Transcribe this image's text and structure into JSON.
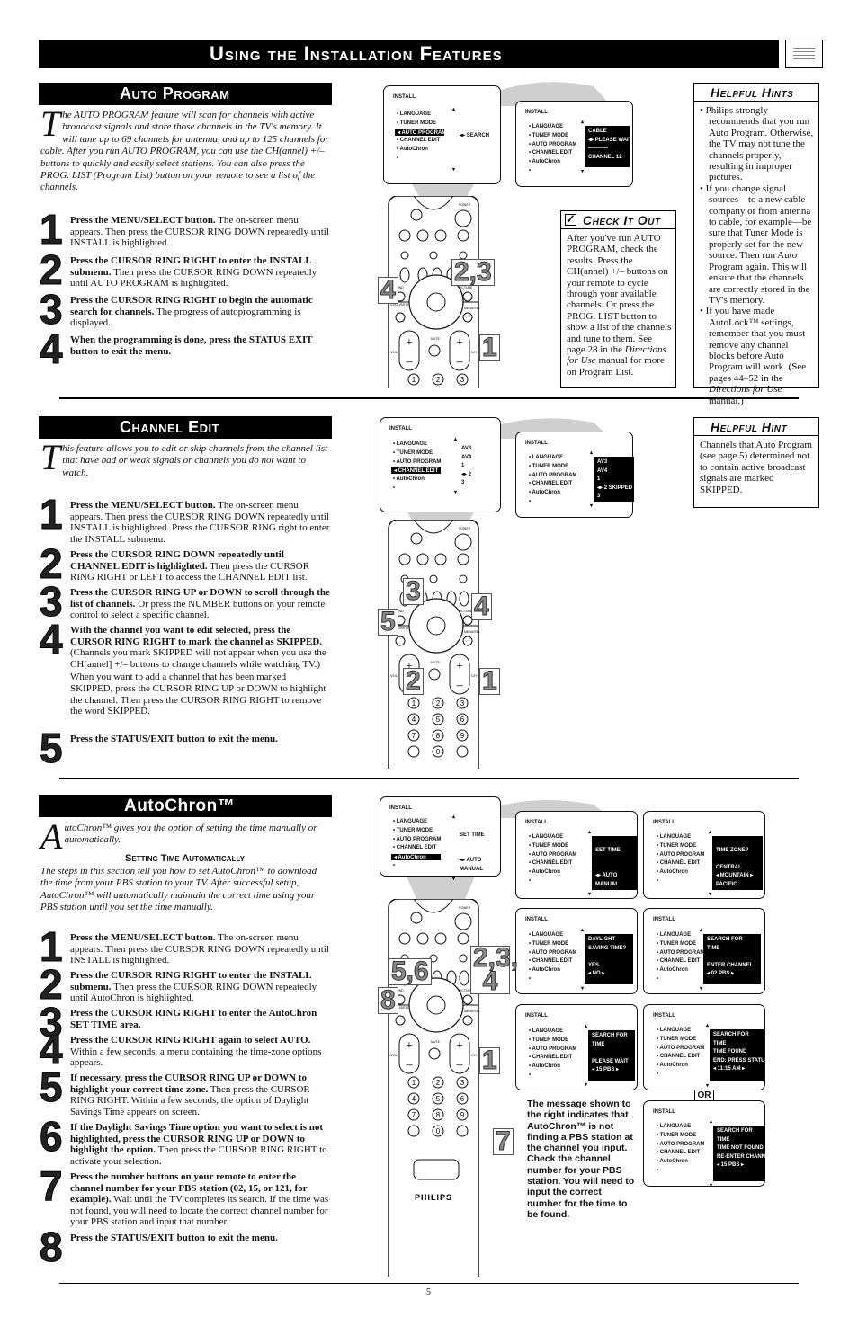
{
  "page_title": "Using the Installation Features",
  "page_number": "5",
  "auto_program": {
    "header": "Auto Program",
    "intro_drop": "T",
    "intro": "he AUTO PROGRAM feature will scan for channels with active broadcast signals and store those channels in the TV's memory. It will tune up to 69 channels for antenna, and up to 125 channels for cable. After you run AUTO PROGRAM, you can use the CH(annel) +/– buttons to quickly and easily select stations. You can also press the PROG. LIST (Program List) button on your remote to see a list of the channels.",
    "steps": [
      {
        "num": "1",
        "bold": "Press the MENU/SELECT button.",
        "text": " The on-screen menu appears. Then press the CURSOR RING DOWN repeatedly until INSTALL is highlighted."
      },
      {
        "num": "2",
        "bold": "Press the CURSOR RING RIGHT to enter the INSTALL submenu.",
        "text": " Then press the CURSOR RING DOWN repeatedly until AUTO PROGRAM is highlighted."
      },
      {
        "num": "3",
        "bold": "Press the CURSOR RING RIGHT to begin the automatic search for channels.",
        "text": " The progress of autoprogramming is displayed."
      },
      {
        "num": "4",
        "bold": "When the programming is done, press the STATUS EXIT button to exit the menu.",
        "text": ""
      }
    ],
    "screens": [
      {
        "title": "INSTALL",
        "items": [
          "LANGUAGE",
          "TUNER MODE",
          "AUTO PROGRAM",
          "CHANNEL EDIT",
          "AutoChron",
          ""
        ],
        "selected": 2,
        "inverted": false,
        "panel": [
          "",
          "",
          "◂▸ SEARCH",
          "",
          "",
          ""
        ]
      },
      {
        "title": "INSTALL",
        "items": [
          "LANGUAGE",
          "TUNER MODE",
          "AUTO PROGRAM",
          "CHANNEL EDIT",
          "AutoChron",
          ""
        ],
        "selected": -1,
        "inverted": true,
        "panel": [
          "CABLE",
          "◂▸ PLEASE WAIT",
          "━━━━━━",
          "CHANNEL   12"
        ]
      }
    ],
    "callouts": [
      "4",
      "2,3",
      "1"
    ],
    "helpful_hints": {
      "title": "Helpful Hints",
      "items": [
        [
          "Philips strongly recommends that you run Auto Program. Otherwise, the TV may not tune the channels properly, resulting in improper pictures."
        ],
        [
          "If you change signal sources—to a new cable company or from antenna to cable, for example—be sure that Tuner Mode is properly set for the new source. Then run Auto Program again. This will ensure that the channels are correctly stored in the TV's memory."
        ],
        [
          "If you have made AutoLock™ settings, remember that you must remove any channel blocks before Auto Program will work. (See pages 44–52 in the ",
          "Directions for Use",
          " manual.)"
        ]
      ]
    },
    "check_it_out": {
      "title": "Check It Out",
      "icon": "checkbox-icon",
      "parts": [
        "After you've run AUTO PROGRAM, check the results. Press the CH(annel) +/– buttons on your remote to cycle through your available channels. Or press the PROG. LIST button to show a list of the channels and tune to them. See page 28 in the ",
        "Directions for Use",
        " manual for more on Program List."
      ]
    }
  },
  "channel_edit": {
    "header": "Channel Edit",
    "intro_drop": "T",
    "intro": "his feature allows you to edit or skip channels from the channel list that have bad or weak signals or channels you do not want to watch.",
    "steps": [
      {
        "num": "1",
        "bold": "Press the MENU/SELECT button.",
        "text": " The on-screen menu appears. Then press the CURSOR RING DOWN repeatedly until INSTALL is highlighted. Press the CURSOR RING right to enter the INSTALL submenu."
      },
      {
        "num": "2",
        "bold": "Press the CURSOR RING DOWN repeatedly until CHANNEL EDIT is highlighted.",
        "text": " Then press the CURSOR RING RIGHT or LEFT to access the CHANNEL EDIT list."
      },
      {
        "num": "3",
        "bold": "Press the CURSOR RING UP or DOWN to scroll through the list of channels.",
        "text": " Or press the NUMBER buttons on your remote control to select a specific channel."
      },
      {
        "num": "4",
        "bold": "With the channel you want to edit selected, press the CURSOR RING RIGHT to mark the channel as SKIPPED.",
        "text": " (Channels you mark SKIPPED will not appear when you use the CH[annel] +/– buttons to change channels while watching TV.)",
        "extra": "When you want to add a channel that has been marked SKIPPED, press the CURSOR RING UP or DOWN to highlight the channel. Then press the CURSOR RING RIGHT to remove the word SKIPPED."
      },
      {
        "num": "5",
        "bold": "Press the STATUS/EXIT button to exit the menu.",
        "text": ""
      }
    ],
    "screens": [
      {
        "title": "INSTALL",
        "items": [
          "LANGUAGE",
          "TUNER MODE",
          "AUTO PROGRAM",
          "CHANNEL EDIT",
          "AutoChron",
          ""
        ],
        "selected": 3,
        "inverted": false,
        "panel": [
          "AV3",
          "AV4",
          "1",
          "◂▸ 2",
          "3"
        ]
      },
      {
        "title": "INSTALL",
        "items": [
          "LANGUAGE",
          "TUNER MODE",
          "AUTO PROGRAM",
          "CHANNEL EDIT",
          "AutoChron",
          ""
        ],
        "selected": -1,
        "inverted": true,
        "panel": [
          "AV3",
          "AV4",
          "1",
          "◂▸ 2    SKIPPED",
          "3"
        ]
      }
    ],
    "callouts": [
      "3",
      "4",
      "5",
      "2",
      "1"
    ],
    "helpful_hint": {
      "title": "Helpful Hint",
      "text": "Channels that Auto Program (see page 5) determined not to contain active broadcast signals are marked SKIPPED."
    }
  },
  "autochron": {
    "header": "AutoChron™",
    "intro_drop": "A",
    "intro": "utoChron™ gives you the option of setting the time manually or automatically.",
    "subheading": "Setting Time Automatically",
    "paragraph": "The steps in this section tell you how to set AutoChron™ to download the time from your PBS station to your TV. After successful setup, AutoChron™ will automatically maintain the correct time using your PBS station until you set the time manually.",
    "steps": [
      {
        "num": "1",
        "bold": "Press the MENU/SELECT button.",
        "text": " The on-screen menu appears. Then press the CURSOR RING DOWN repeatedly until INSTALL is highlighted."
      },
      {
        "num": "2",
        "bold": "Press the CURSOR RING RIGHT to enter the INSTALL submenu.",
        "text": " Then press the CURSOR RING DOWN repeatedly until AutoChron is highlighted."
      },
      {
        "num": "3",
        "bold": "Press the CURSOR RING RIGHT to enter the AutoChron SET TIME area.",
        "text": ""
      },
      {
        "num": "4",
        "bold": "Press the CURSOR RING RIGHT again to select AUTO.",
        "text": " Within a few seconds, a menu containing the time-zone options appears."
      },
      {
        "num": "5",
        "bold": "If necessary, press the CURSOR RING UP or DOWN to highlight your correct time zone.",
        "text": " Then press the CURSOR RING RIGHT. Within a few seconds, the option of Daylight Savings Time appears on screen."
      },
      {
        "num": "6",
        "bold": "If the Daylight Savings Time option you want to select is not highlighted, press the CURSOR RING UP or DOWN to highlight the option.",
        "text": " Then press the CURSOR RING RIGHT to activate your selection."
      },
      {
        "num": "7",
        "bold": "Press the number buttons on your remote to enter the channel number for your PBS station (02, 15, or 121, for example).",
        "text": " Wait until the TV completes its search. If the time was not found, you will need to locate the correct channel number for your PBS station and input that number."
      },
      {
        "num": "8",
        "bold": "Press the STATUS/EXIT button to exit the menu.",
        "text": ""
      }
    ],
    "screens": [
      {
        "title": "INSTALL",
        "items": [
          "LANGUAGE",
          "TUNER MODE",
          "AUTO PROGRAM",
          "CHANNEL EDIT",
          "AutoChron",
          ""
        ],
        "selected": 4,
        "inverted": false,
        "panel": [
          "",
          "SET TIME",
          "",
          "",
          "◂▸ AUTO",
          "MANUAL"
        ]
      },
      {
        "title": "INSTALL",
        "items": [
          "LANGUAGE",
          "TUNER MODE",
          "AUTO PROGRAM",
          "CHANNEL EDIT",
          "AutoChron",
          ""
        ],
        "selected": -1,
        "inverted": true,
        "panel": [
          "",
          "SET TIME",
          "",
          "",
          "◂▸ AUTO",
          "    MANUAL"
        ]
      },
      {
        "title": "INSTALL",
        "items": [
          "LANGUAGE",
          "TUNER MODE",
          "AUTO PROGRAM",
          "CHANNEL EDIT",
          "AutoChron",
          ""
        ],
        "selected": -1,
        "inverted": true,
        "panel": [
          "",
          "TIME ZONE?",
          "",
          "CENTRAL",
          "◂ MOUNTAIN  ▸",
          "PACIFIC"
        ]
      },
      {
        "title": "INSTALL",
        "items": [
          "LANGUAGE",
          "TUNER MODE",
          "AUTO PROGRAM",
          "CHANNEL EDIT",
          "AutoChron",
          ""
        ],
        "selected": -1,
        "inverted": true,
        "panel": [
          "DAYLIGHT",
          "SAVING TIME?",
          "",
          "YES",
          "◂ NO          ▸"
        ]
      },
      {
        "title": "INSTALL",
        "items": [
          "LANGUAGE",
          "TUNER MODE",
          "AUTO PROGRAM",
          "CHANNEL EDIT",
          "AutoChron",
          ""
        ],
        "selected": -1,
        "inverted": true,
        "panel": [
          "SEARCH  FOR",
          "TIME",
          "",
          "ENTER CHANNEL",
          "◂ 02     PBS  ▸"
        ]
      },
      {
        "title": "INSTALL",
        "items": [
          "LANGUAGE",
          "TUNER MODE",
          "AUTO PROGRAM",
          "CHANNEL EDIT",
          "AutoChron",
          ""
        ],
        "selected": -1,
        "inverted": true,
        "panel": [
          "SEARCH  FOR",
          "TIME",
          "",
          "PLEASE WAIT",
          "◂ 15     PBS  ▸"
        ]
      },
      {
        "title": "INSTALL",
        "items": [
          "LANGUAGE",
          "TUNER MODE",
          "AUTO PROGRAM",
          "CHANNEL EDIT",
          "AutoChron",
          ""
        ],
        "selected": -1,
        "inverted": true,
        "panel": [
          "SEARCH  FOR",
          "TIME",
          "TIME FOUND",
          "END: PRESS STATUS",
          "◂ 11:15 AM    ▸"
        ]
      },
      {
        "title": "INSTALL",
        "items": [
          "LANGUAGE",
          "TUNER MODE",
          "AUTO PROGRAM",
          "CHANNEL EDIT",
          "AutoChron",
          ""
        ],
        "selected": -1,
        "inverted": true,
        "panel": [
          "SEARCH  FOR",
          "TIME",
          "TIME NOT FOUND",
          "RE-ENTER CHANNEL",
          "◂ 15     PBS  ▸"
        ]
      }
    ],
    "or_label": "OR",
    "note": "The message shown to the right indicates that AutoChron™ is not finding a PBS station at the channel you input. Check the channel number for your PBS station. You will need to input the correct number for the time to be found.",
    "callouts": [
      "5,6",
      "2,3, 4",
      "8",
      "1",
      "7"
    ]
  },
  "remote": {
    "brand": "PHILIPS",
    "labels": {
      "power": "POWER",
      "vol": "VOL",
      "ch": "CH",
      "mute": "MUTE",
      "sound": "SOUND",
      "picture": "PICTURE",
      "status": "STATUS/EXIT",
      "menu": "MENU/SELECT"
    }
  }
}
